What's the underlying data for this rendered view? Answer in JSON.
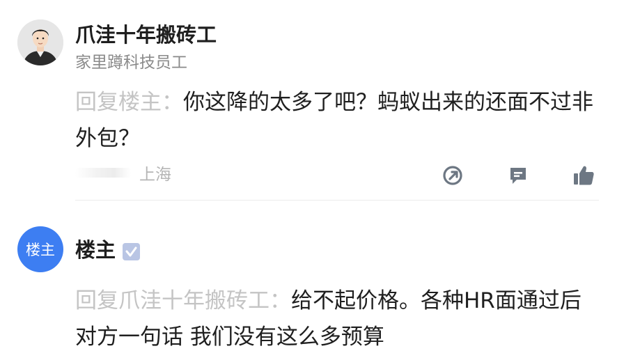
{
  "comments": [
    {
      "username": "爪洼十年搬砖工",
      "subtitle": "家里蹲科技员工",
      "reply_prefix": "回复楼主：",
      "text": "你这降的太多了吧？蚂蚁出来的还面不过非外包？",
      "location": "上海",
      "avatar_icon": "user-photo-icon",
      "actions": [
        "share-icon",
        "comment-icon",
        "thumbs-up-icon"
      ]
    },
    {
      "username": "楼主",
      "avatar_label": "楼主",
      "badge_icon": "verified-icon",
      "reply_prefix": "回复爪洼十年搬砖工：",
      "text": "给不起价格。各种HR面通过后 对方一句话 我们没有这么多预算"
    }
  ],
  "colors": {
    "op_avatar": "#3d7ef2",
    "reply_prefix": "#c4c4c4",
    "icon": "#6d7783",
    "badge": "#b9c5e4"
  }
}
